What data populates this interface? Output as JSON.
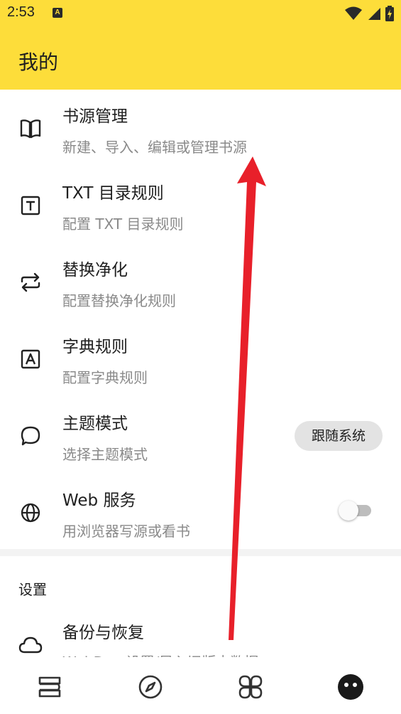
{
  "status_bar": {
    "time": "2:53",
    "notification_icon": "a-badge-icon",
    "icons": [
      "wifi-icon",
      "cellular-signal-icon",
      "battery-charging-icon"
    ]
  },
  "app_bar": {
    "title": "我的",
    "background_color": "#fddd3a"
  },
  "menu_items": [
    {
      "icon": "book-open-icon",
      "title": "书源管理",
      "subtitle": "新建、导入、编辑或管理书源"
    },
    {
      "icon": "text-t-icon",
      "title": "TXT 目录规则",
      "subtitle": "配置 TXT 目录规则"
    },
    {
      "icon": "swap-arrows-icon",
      "title": "替换净化",
      "subtitle": "配置替换净化规则"
    },
    {
      "icon": "dictionary-a-icon",
      "title": "字典规则",
      "subtitle": "配置字典规则"
    },
    {
      "icon": "theme-bubble-icon",
      "title": "主题模式",
      "subtitle": "选择主题模式",
      "value": "跟随系统"
    },
    {
      "icon": "globe-icon",
      "title": "Web 服务",
      "subtitle": "用浏览器写源或看书",
      "switch_on": false
    }
  ],
  "settings_section": {
    "label": "设置",
    "items": [
      {
        "icon": "cloud-icon",
        "title": "备份与恢复",
        "subtitle": "WebDav 设置/导入旧版本数据"
      }
    ]
  },
  "bottom_nav": [
    {
      "icon": "bookshelf-icon",
      "active": false
    },
    {
      "icon": "compass-icon",
      "active": false
    },
    {
      "icon": "rss-grid-icon",
      "active": false
    },
    {
      "icon": "profile-face-icon",
      "active": true
    }
  ],
  "annotation": {
    "arrow_color": "#e8202a"
  }
}
